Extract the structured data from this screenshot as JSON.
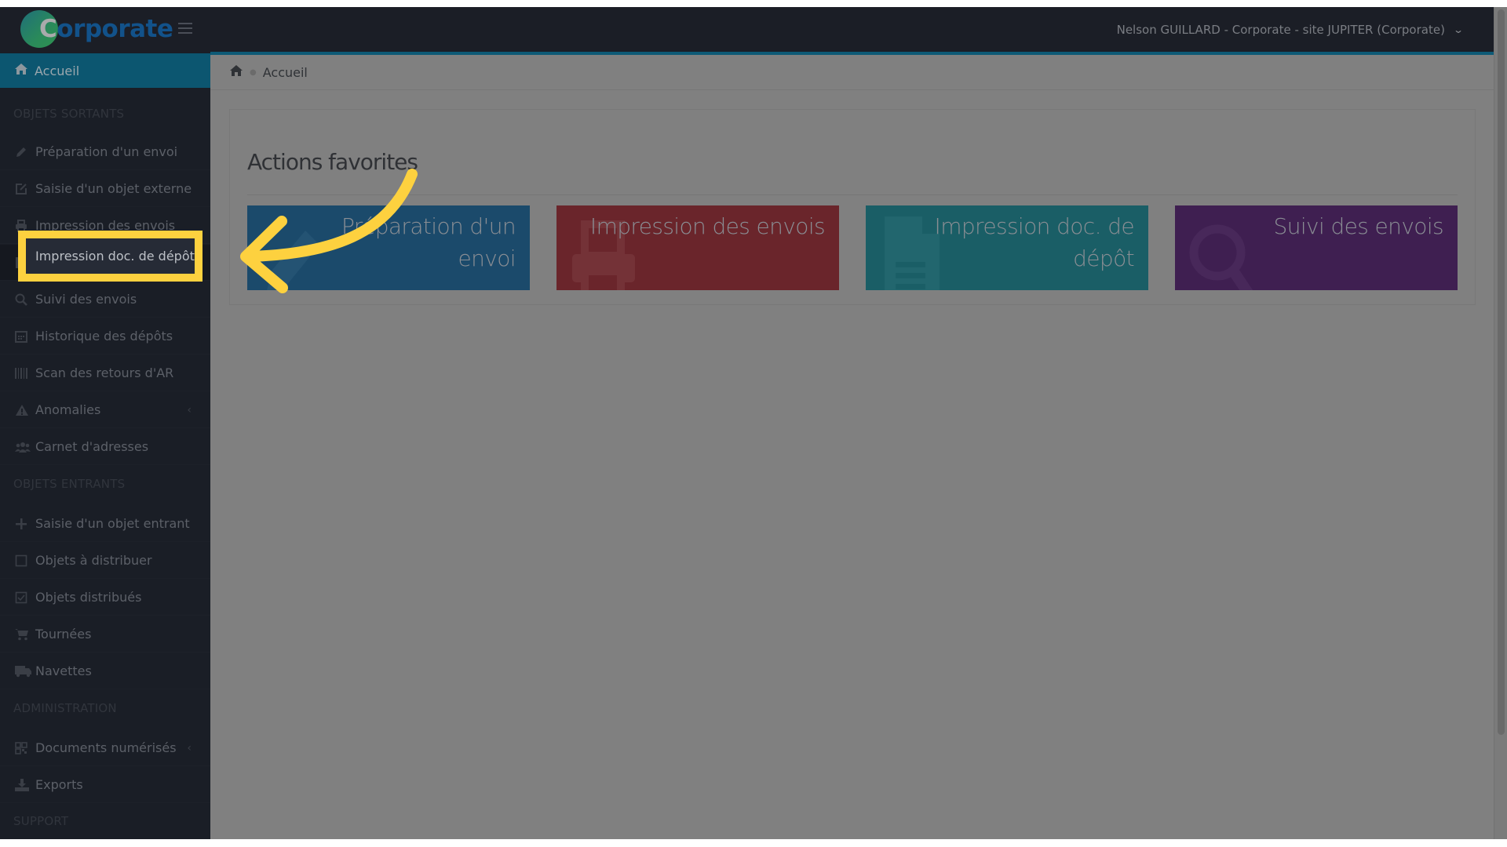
{
  "header": {
    "logo_initial": "C",
    "logo_rest": "orporate",
    "user_menu_label": "Nelson GUILLARD - Corporate - site JUPITER (Corporate)",
    "user_menu_icon": "chevron-down-icon"
  },
  "sidebar": {
    "active_item": {
      "label": "Accueil",
      "icon": "home-icon"
    },
    "sections": [
      {
        "title": "OBJETS SORTANTS",
        "items": [
          {
            "label": "Préparation d'un envoi",
            "icon": "pencil-icon"
          },
          {
            "label": "Saisie d'un objet externe",
            "icon": "external-edit-icon"
          },
          {
            "label": "Impression des envois",
            "icon": "printer-icon"
          },
          {
            "label": "Impression doc. de dépôt",
            "icon": "document-icon"
          },
          {
            "label": "Suivi des envois",
            "icon": "search-icon"
          },
          {
            "label": "Historique des dépôts",
            "icon": "calendar-icon"
          },
          {
            "label": "Scan des retours d'AR",
            "icon": "barcode-icon"
          },
          {
            "label": "Anomalies",
            "icon": "warning-icon",
            "has_submenu": true
          },
          {
            "label": "Carnet d'adresses",
            "icon": "users-icon"
          }
        ]
      },
      {
        "title": "OBJETS ENTRANTS",
        "items": [
          {
            "label": "Saisie d'un objet entrant",
            "icon": "plus-icon"
          },
          {
            "label": "Objets à distribuer",
            "icon": "checkbox-empty-icon"
          },
          {
            "label": "Objets distribués",
            "icon": "checkbox-checked-icon"
          },
          {
            "label": "Tournées",
            "icon": "cart-icon"
          },
          {
            "label": "Navettes",
            "icon": "truck-icon"
          }
        ]
      },
      {
        "title": "ADMINISTRATION",
        "items": [
          {
            "label": "Documents numérisés",
            "icon": "qrcode-icon",
            "has_submenu": true
          },
          {
            "label": "Exports",
            "icon": "download-icon"
          }
        ]
      },
      {
        "title": "SUPPORT",
        "items": []
      }
    ],
    "highlighted_item_label": "Impression doc. de dépôt"
  },
  "breadcrumb": {
    "home_icon": "home-icon",
    "current": "Accueil"
  },
  "favorites": {
    "title": "Actions favorites",
    "tiles": [
      {
        "label": "Préparation d'un envoi",
        "icon": "pencil-icon",
        "color": "#1b4a6b"
      },
      {
        "label": "Impression des envois",
        "icon": "printer-icon",
        "color": "#6a252b"
      },
      {
        "label": "Impression doc. de dépôt",
        "icon": "document-icon",
        "color": "#1a5e66"
      },
      {
        "label": "Suivi des envois",
        "icon": "search-icon",
        "color": "#3f1f51"
      }
    ]
  },
  "annotation": {
    "type": "arrow-and-highlight",
    "color": "#fdd13f"
  }
}
